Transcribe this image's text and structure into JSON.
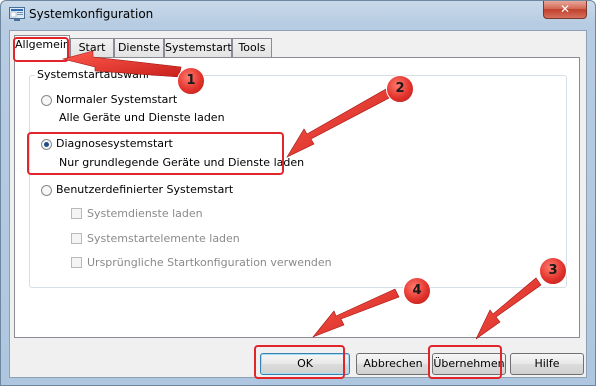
{
  "window": {
    "title": "Systemkonfiguration",
    "close_glyph": "✕"
  },
  "tabs": [
    {
      "label": "Allgemein",
      "active": true
    },
    {
      "label": "Start",
      "active": false
    },
    {
      "label": "Dienste",
      "active": false
    },
    {
      "label": "Systemstart",
      "active": false
    },
    {
      "label": "Tools",
      "active": false
    }
  ],
  "startup_selection": {
    "group_label": "Systemstartauswahl",
    "normal": {
      "label": "Normaler Systemstart",
      "description": "Alle Geräte und Dienste laden",
      "checked": false
    },
    "diagnostic": {
      "label": "Diagnosesystemstart",
      "description": "Nur grundlegende Geräte und Dienste laden",
      "checked": true
    },
    "selective": {
      "label": "Benutzerdefinierter Systemstart",
      "checked": false,
      "options": [
        {
          "label": "Systemdienste laden",
          "checked": false
        },
        {
          "label": "Systemstartelemente laden",
          "checked": false
        },
        {
          "label": "Ursprüngliche Startkonfiguration verwenden",
          "checked": false
        }
      ]
    }
  },
  "buttons": {
    "ok": "OK",
    "cancel": "Abbrechen",
    "apply": "Übernehmen",
    "help": "Hilfe"
  },
  "annotations": {
    "badge_1": "1",
    "badge_2": "2",
    "badge_3": "3",
    "badge_4": "4",
    "color": "#e1262b"
  }
}
